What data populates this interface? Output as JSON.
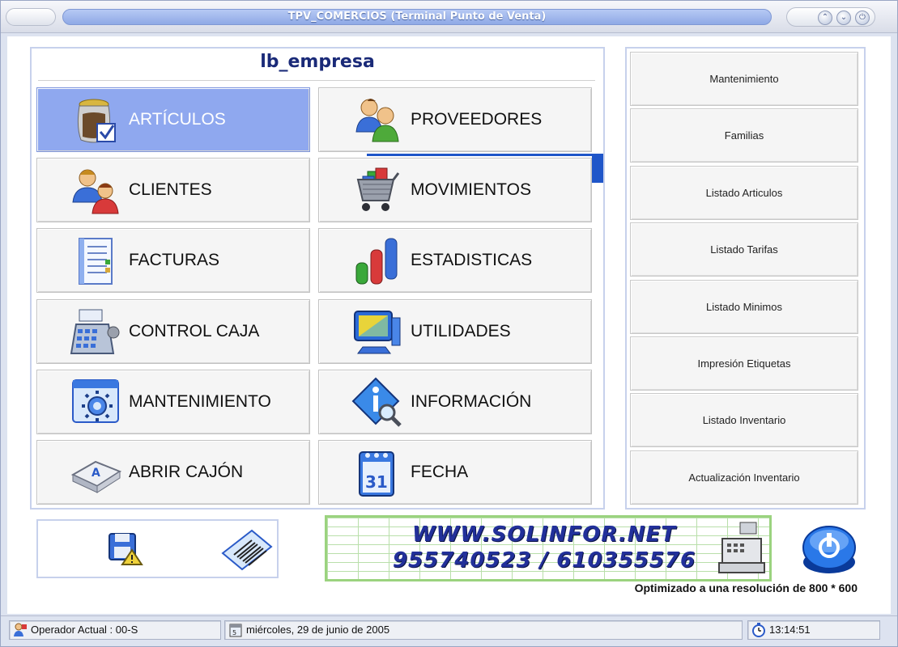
{
  "window": {
    "title": "TPV_COMERCIOS  (Terminal Punto de Venta)"
  },
  "company": "lb_empresa",
  "main_buttons": [
    {
      "label": "ARTÍCULOS",
      "icon": "jar-checkbox-icon",
      "active": true
    },
    {
      "label": "PROVEEDORES",
      "icon": "people-icon"
    },
    {
      "label": "CLIENTES",
      "icon": "users-icon"
    },
    {
      "label": "MOVIMIENTOS",
      "icon": "shopping-cart-icon"
    },
    {
      "label": "FACTURAS",
      "icon": "invoice-icon"
    },
    {
      "label": "ESTADISTICAS",
      "icon": "bar-chart-icon"
    },
    {
      "label": "CONTROL CAJA",
      "icon": "cash-register-icon"
    },
    {
      "label": "UTILIDADES",
      "icon": "computer-icon"
    },
    {
      "label": "MANTENIMIENTO",
      "icon": "settings-window-icon"
    },
    {
      "label": "INFORMACIÓN",
      "icon": "info-magnifier-icon"
    },
    {
      "label": "ABRIR CAJÓN",
      "icon": "keyboard-key-icon"
    },
    {
      "label": "FECHA",
      "icon": "calendar-icon"
    }
  ],
  "side_buttons": [
    "Mantenimiento",
    "Familias",
    "Listado Articulos",
    "Listado Tarifas",
    "Listado Minimos",
    "Impresión Etiquetas",
    "Listado Inventario",
    "Actualización Inventario"
  ],
  "banner": {
    "line1": "WWW.SOLINFOR.NET",
    "line2": "955740523 / 610355576"
  },
  "resolution_note": "Optimizado a una resolución de 800 * 600",
  "status": {
    "operator": "Operador Actual : 00-S",
    "date": "miércoles, 29 de junio de 2005",
    "time": "13:14:51"
  },
  "colors": {
    "accent": "#8fa8ef",
    "title_text": "#1a2a78",
    "banner_text": "#22309a"
  }
}
